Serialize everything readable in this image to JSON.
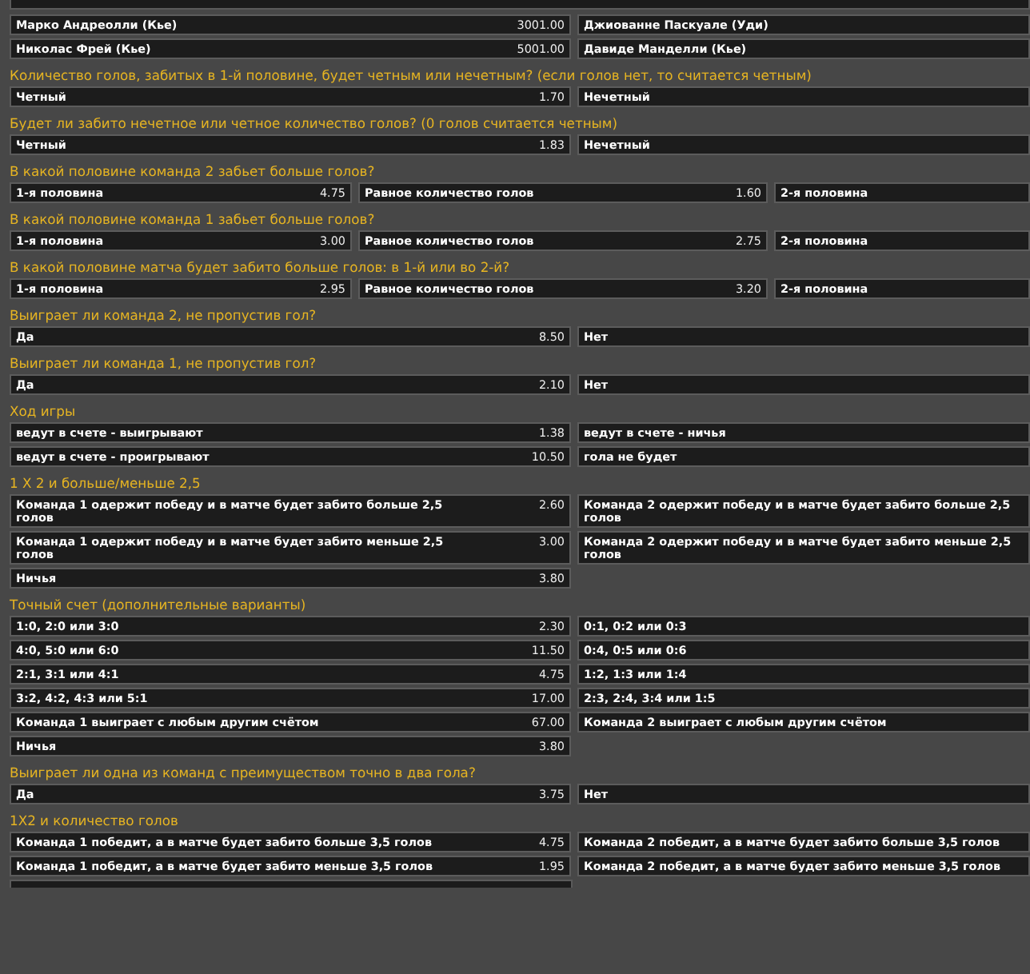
{
  "markets": [
    {
      "kind": "two-way",
      "rows": [
        [
          {
            "label": "Марко Андреолли (Кье)",
            "odds": "3001.00"
          },
          {
            "label": "Джиованне Паскуале (Уди)"
          }
        ],
        [
          {
            "label": "Николас Фрей (Кье)",
            "odds": "5001.00"
          },
          {
            "label": "Давиде Манделли (Кье)"
          }
        ]
      ]
    },
    {
      "title": "Количество голов, забитых в 1-й половине, будет четным или нечетным? (если голов нет, то считается четным)",
      "kind": "two-way",
      "rows": [
        [
          {
            "label": "Четный",
            "odds": "1.70"
          },
          {
            "label": "Нечетный"
          }
        ]
      ]
    },
    {
      "title": "Будет ли забито нечетное или четное количество голов? (0 голов считается четным)",
      "kind": "two-way",
      "rows": [
        [
          {
            "label": "Четный",
            "odds": "1.83"
          },
          {
            "label": "Нечетный"
          }
        ]
      ]
    },
    {
      "title": "В какой половине команда 2 забьет больше голов?",
      "kind": "three-way",
      "rows": [
        [
          {
            "label": "1-я половина",
            "odds": "4.75"
          },
          {
            "label": "Равное количество голов",
            "odds": "1.60"
          },
          {
            "label": "2-я половина"
          }
        ]
      ]
    },
    {
      "title": "В какой половине команда 1 забьет больше голов?",
      "kind": "three-way",
      "rows": [
        [
          {
            "label": "1-я половина",
            "odds": "3.00"
          },
          {
            "label": "Равное количество голов",
            "odds": "2.75"
          },
          {
            "label": "2-я половина"
          }
        ]
      ]
    },
    {
      "title": "В какой половине матча будет забито больше голов: в 1-й или во 2-й?",
      "kind": "three-way",
      "rows": [
        [
          {
            "label": "1-я половина",
            "odds": "2.95"
          },
          {
            "label": "Равное количество голов",
            "odds": "3.20"
          },
          {
            "label": "2-я половина"
          }
        ]
      ]
    },
    {
      "title": "Выиграет ли команда 2, не пропустив гол?",
      "kind": "two-way",
      "rows": [
        [
          {
            "label": "Да",
            "odds": "8.50"
          },
          {
            "label": "Нет"
          }
        ]
      ]
    },
    {
      "title": "Выиграет ли команда 1, не пропустив гол?",
      "kind": "two-way",
      "rows": [
        [
          {
            "label": "Да",
            "odds": "2.10"
          },
          {
            "label": "Нет"
          }
        ]
      ]
    },
    {
      "title": "Ход игры",
      "kind": "two-way",
      "rows": [
        [
          {
            "label": "ведут в счете - выигрывают",
            "odds": "1.38"
          },
          {
            "label": "ведут в счете - ничья"
          }
        ],
        [
          {
            "label": "ведут в счете - проигрывают",
            "odds": "10.50"
          },
          {
            "label": "гола не будет"
          }
        ]
      ]
    },
    {
      "title": "1 X 2 и больше/меньше 2,5",
      "kind": "two-way",
      "rows": [
        [
          {
            "label": "Команда 1 одержит победу и в матче будет забито больше 2,5 голов",
            "odds": "2.60"
          },
          {
            "label": "Команда 2 одержит победу и в матче будет забито больше 2,5 голов"
          }
        ],
        [
          {
            "label": "Команда 1 одержит победу и в матче будет забито меньше 2,5 голов",
            "odds": "3.00"
          },
          {
            "label": "Команда 2 одержит победу и в матче будет забито меньше 2,5 голов"
          }
        ],
        [
          {
            "label": "Ничья",
            "odds": "3.80"
          }
        ]
      ]
    },
    {
      "title": "Точный счет (дополнительные варианты)",
      "kind": "two-way",
      "rows": [
        [
          {
            "label": "1:0, 2:0 или 3:0",
            "odds": "2.30"
          },
          {
            "label": "0:1, 0:2 или 0:3"
          }
        ],
        [
          {
            "label": "4:0, 5:0 или 6:0",
            "odds": "11.50"
          },
          {
            "label": "0:4, 0:5 или 0:6"
          }
        ],
        [
          {
            "label": "2:1, 3:1 или 4:1",
            "odds": "4.75"
          },
          {
            "label": "1:2, 1:3 или 1:4"
          }
        ],
        [
          {
            "label": "3:2, 4:2, 4:3 или 5:1",
            "odds": "17.00"
          },
          {
            "label": "2:3, 2:4, 3:4 или 1:5"
          }
        ],
        [
          {
            "label": "Команда 1 выиграет с любым другим счётом",
            "odds": "67.00"
          },
          {
            "label": "Команда 2 выиграет с любым другим счётом"
          }
        ],
        [
          {
            "label": "Ничья",
            "odds": "3.80"
          }
        ]
      ]
    },
    {
      "title": "Выиграет ли одна из команд с преимуществом точно в два гола?",
      "kind": "two-way",
      "rows": [
        [
          {
            "label": "Да",
            "odds": "3.75"
          },
          {
            "label": "Нет"
          }
        ]
      ]
    },
    {
      "title": "1X2 и количество голов",
      "kind": "two-way",
      "rows": [
        [
          {
            "label": "Команда 1 победит, а в матче будет забито больше 3,5 голов",
            "odds": "4.75"
          },
          {
            "label": "Команда 2 победит, а в матче будет забито больше 3,5 голов"
          }
        ],
        [
          {
            "label": "Команда 1 победит, а в матче будет забито меньше 3,5 голов",
            "odds": "1.95"
          },
          {
            "label": "Команда 2 победит, а в матче будет забито меньше 3,5 голов"
          }
        ]
      ]
    }
  ]
}
